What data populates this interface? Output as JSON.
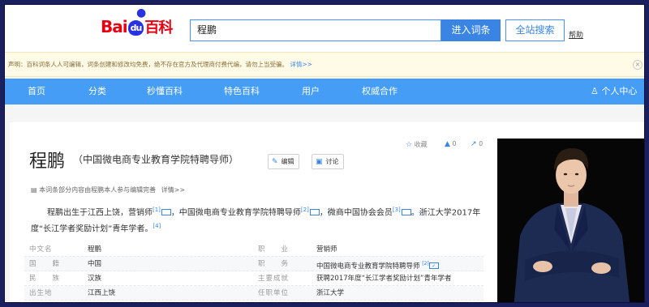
{
  "header": {
    "logo_bai": "Bai",
    "logo_du": "du",
    "logo_baike": "百科",
    "search_value": "程鹏",
    "enter_button": "进入词条",
    "all_search_button": "全站搜索",
    "help_link": "帮助"
  },
  "notice": {
    "text": "声明：百科词条人人可编辑，词条创建和修改均免费，绝不存在官方及代理商付费代编，请勿上当受骗。",
    "more_link": "详情>>",
    "close_icon": "×"
  },
  "nav": {
    "items": [
      "首页",
      "分类",
      "秒懂百科",
      "特色百科",
      "用户",
      "权威合作"
    ],
    "user_center": "个人中心",
    "user_icon": "♙"
  },
  "entry": {
    "title": "程鹏",
    "subtitle": "（中国微电商专业教育学院特聘导师）",
    "edit_button": "编辑",
    "discuss_button": "讨论",
    "collect_label": "收藏",
    "like_count": "0",
    "share_count": "0",
    "edit_note": "本词条部分内容由程鹏本人参与编辑完善",
    "edit_note_detail": "详情>>",
    "para_1": "程鹏出生于江西上饶，营销师",
    "ref_1": "[1]",
    "para_2": "，中国微电商专业教育学院特聘导师",
    "ref_2": "[2]",
    "para_3": "，微商中国协会会员",
    "ref_3": "[3]",
    "para_4": "。浙江大学2017年度“长江学者奖励计划”青年学者。",
    "ref_4": "[4]"
  },
  "basic_info": [
    {
      "name": "中文名",
      "value": "程鹏",
      "name2": "职　　业",
      "value2": "营销师",
      "ref2": ""
    },
    {
      "name": "国　　籍",
      "value": "中国",
      "name2": "职　　务",
      "value2": "中国微电商专业教育学院特聘导师",
      "ref2": "[2]"
    },
    {
      "name": "民　　族",
      "value": "汉族",
      "name2": "主要成就",
      "value2": "获聘2017年度“长江学者奖励计划”青年学者",
      "ref2": ""
    },
    {
      "name": "出生地",
      "value": "江西上饶",
      "name2": "任职单位",
      "value2": "浙江大学",
      "ref2": ""
    }
  ]
}
